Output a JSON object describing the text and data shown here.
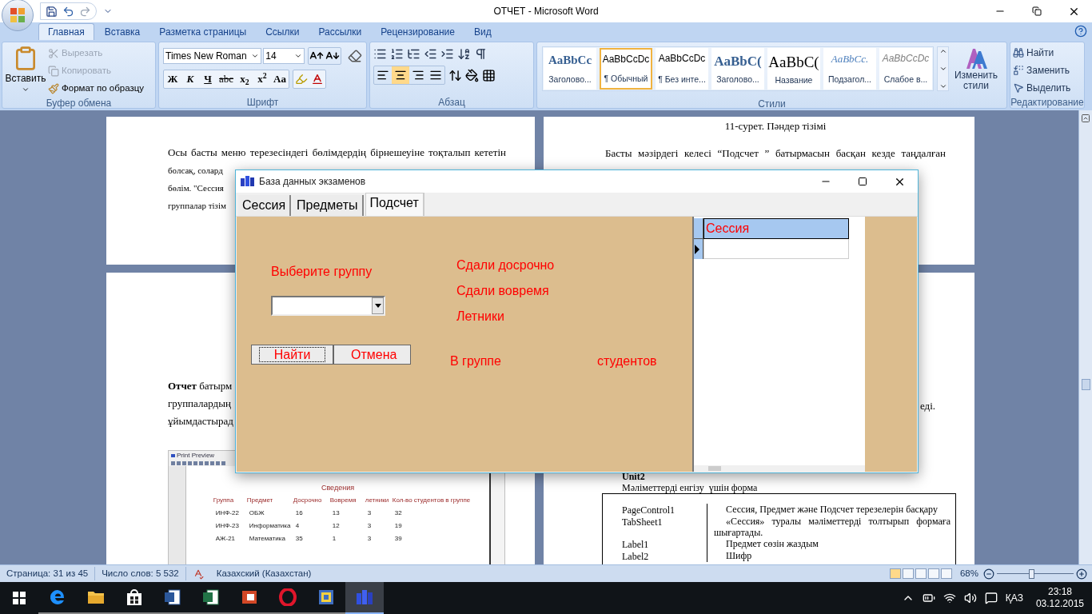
{
  "word": {
    "title": "ОТЧЕТ - Microsoft Word",
    "ribbon_tabs": [
      {
        "label": "Главная",
        "selected": true
      },
      {
        "label": "Вставка",
        "selected": false
      },
      {
        "label": "Разметка страницы",
        "selected": false
      },
      {
        "label": "Ссылки",
        "selected": false
      },
      {
        "label": "Рассылки",
        "selected": false
      },
      {
        "label": "Рецензирование",
        "selected": false
      },
      {
        "label": "Вид",
        "selected": false
      }
    ],
    "clipboard": {
      "group": "Буфер обмена",
      "paste": "Вставить",
      "items": [
        {
          "kind": "cut",
          "label": "Вырезать",
          "disabled": true
        },
        {
          "kind": "copy",
          "label": "Копировать",
          "disabled": true
        },
        {
          "kind": "format",
          "label": "Формат по образцу",
          "disabled": false
        }
      ]
    },
    "font": {
      "group": "Шрифт",
      "family": "Times New Roman",
      "size": "14",
      "buttons": [
        "Ж",
        "К",
        "Ч",
        "abc",
        "x$_{2}$",
        "x$^{2}$",
        "Aa"
      ]
    },
    "paragraph": {
      "group": "Абзац",
      "alignments": [
        {
          "kind": "left",
          "selected": false
        },
        {
          "kind": "center",
          "selected": true
        },
        {
          "kind": "right",
          "selected": false
        },
        {
          "kind": "justify",
          "selected": false
        }
      ]
    },
    "styles": {
      "group": "Стили",
      "change": "Изменить стили",
      "items": [
        {
          "kind": "heading1",
          "sample": "AaBbCc",
          "label": "Заголово...",
          "selected": false
        },
        {
          "kind": "normal",
          "sample": "AaBbCcDc",
          "label": "¶ Обычный",
          "selected": true
        },
        {
          "kind": "normal",
          "sample": "AaBbCcDc",
          "label": "¶ Без инте...",
          "selected": false
        },
        {
          "kind": "heading2",
          "sample": "AaBbC(",
          "label": "Заголово...",
          "selected": false
        },
        {
          "kind": "title",
          "sample": "AaBbC(",
          "label": "Название",
          "selected": false
        },
        {
          "kind": "subtitle",
          "sample": "AaBbCc.",
          "label": "Подзагол...",
          "selected": false
        },
        {
          "kind": "subtle",
          "sample": "AaBbCcDc",
          "label": "Слабое в...",
          "selected": false
        }
      ]
    },
    "editing": {
      "group": "Редактирование",
      "items": [
        {
          "kind": "find",
          "label": "Найти"
        },
        {
          "kind": "replace",
          "label": "Заменить"
        },
        {
          "kind": "select",
          "label": "Выделить"
        }
      ]
    }
  },
  "document": {
    "page_top_left": [
      "Осы басты меню терезесіндегі бөлімдердің бірнешеуіне тоқталып кететін",
      "болсақ, солард",
      "бөлім. \"Сессия",
      "группалар тізім"
    ],
    "page_top_right": {
      "caption": "11-сурет. Пәндер тізімі",
      "lines": [
        "Басты мәзірдегі келесі “Подсчет ” батырмасын басқан кезде таңдалған"
      ]
    },
    "page_bottom_left": [
      "**Отчет** батырм",
      "группалардың",
      "ұйымдастырад"
    ],
    "preview": {
      "title": "Print Preview",
      "heading": "Сведения",
      "columns": [
        "Группа",
        "Предмет",
        "Досрочно",
        "Вовремя",
        "летники",
        "Кол-во студентов в группе"
      ],
      "rows": [
        [
          "ИНФ-22",
          "ОБЖ",
          "16",
          "13",
          "3",
          "32"
        ],
        [
          "ИНФ-23",
          "Информатика",
          "4",
          "12",
          "3",
          "19"
        ],
        [
          "АЖ-21",
          "Математика",
          "35",
          "1",
          "3",
          "39"
        ]
      ]
    },
    "page_bottom_right": {
      "fragment": "еді.",
      "unit": "Unit2",
      "subtitle": "Мәліметтерді енгізу  үшін форма",
      "table": [
        {
          "name": "PageControl1",
          "description": "Сессия, Предмет және Подсчет терезелерін басқару"
        },
        {
          "name": "TabSheet1",
          "description": "«Сессия» туралы мәліметтерді толтырып формаға шығартады."
        },
        {
          "name": "Label1",
          "description": "Предмет сөзін жаздым"
        },
        {
          "name": "Label2",
          "description": "Шифр"
        }
      ]
    }
  },
  "dialog": {
    "title": "База данных экзаменов",
    "tabs": [
      {
        "label": "Сессия",
        "selected": false
      },
      {
        "label": "Предметы",
        "selected": false
      },
      {
        "label": "Подсчет",
        "selected": true
      }
    ],
    "group_label": "Выберите группу",
    "stats": [
      "Сдали досрочно",
      "Сдали вовремя",
      "Летники"
    ],
    "buttons": [
      {
        "label": "Найти",
        "focused": true
      },
      {
        "label": "Отмена",
        "focused": false
      }
    ],
    "group_count": [
      "В группе",
      "студентов"
    ],
    "grid": {
      "columns": [
        "Сессия"
      ],
      "rows": [
        {
          "current": true
        }
      ]
    }
  },
  "status_bar": {
    "page": "Страница: 31 из 45",
    "words": "Число слов: 5 532",
    "language": "Казахский (Казахстан)",
    "zoom": "68%",
    "zoom_slider": {
      "level": 0.45
    }
  },
  "taskbar": {
    "apps": [
      {
        "kind": "browser",
        "active": false
      },
      {
        "kind": "folder",
        "active": false
      },
      {
        "kind": "store",
        "active": false
      },
      {
        "kind": "word",
        "active": false
      },
      {
        "kind": "excel",
        "active": false
      },
      {
        "kind": "access",
        "active": false
      },
      {
        "kind": "opera",
        "active": false
      },
      {
        "kind": "ide",
        "active": false
      },
      {
        "kind": "database",
        "active": true
      }
    ],
    "language": "ҚАЗ",
    "time": "23:18",
    "date": "03.12.2015"
  }
}
